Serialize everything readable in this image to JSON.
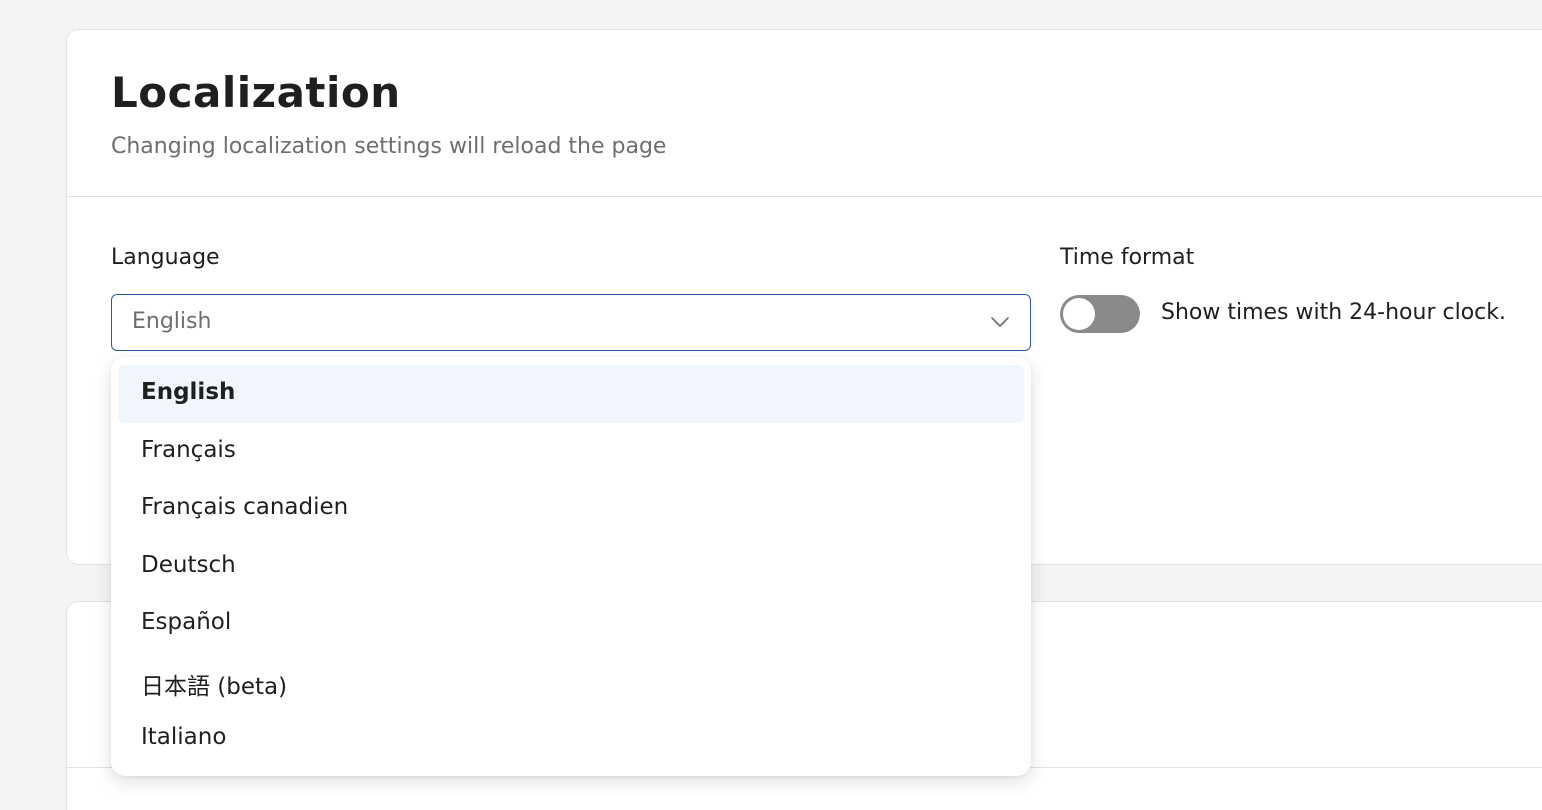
{
  "section": {
    "title": "Localization",
    "subtitle": "Changing localization settings will reload the page"
  },
  "language": {
    "label": "Language",
    "selected_value": "English",
    "options": [
      {
        "label": "English",
        "selected": true
      },
      {
        "label": "Français",
        "selected": false
      },
      {
        "label": "Français canadien",
        "selected": false
      },
      {
        "label": "Deutsch",
        "selected": false
      },
      {
        "label": "Español",
        "selected": false
      },
      {
        "label": "日本語 (beta)",
        "selected": false
      },
      {
        "label": "Italiano",
        "selected": false
      }
    ]
  },
  "time_format": {
    "label": "Time format",
    "toggle_text": "Show times with 24-hour clock.",
    "enabled": false
  },
  "colors": {
    "select_border": "#2b5a9e",
    "selected_option_bg": "#f0f6fc",
    "toggle_off": "#8a8a8a"
  },
  "icons": {
    "select_chevron": "chevron-down-icon"
  }
}
